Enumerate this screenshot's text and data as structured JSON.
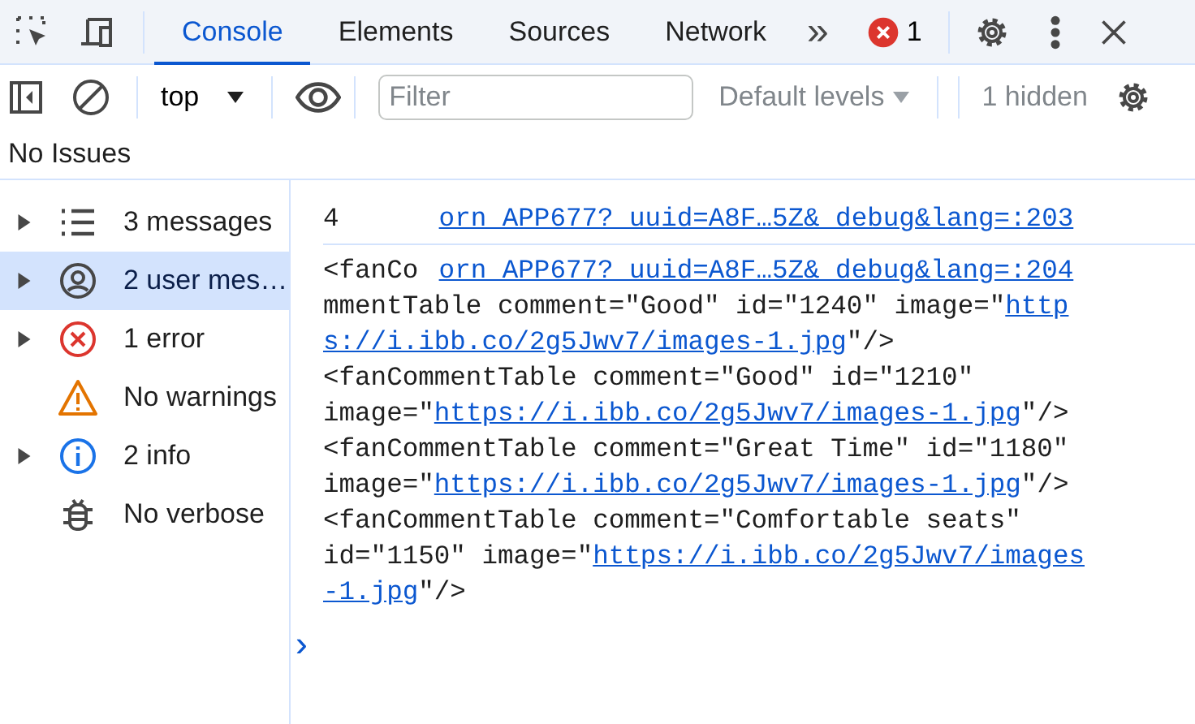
{
  "tabs": [
    {
      "label": "Console",
      "selected": true
    },
    {
      "label": "Elements",
      "selected": false
    },
    {
      "label": "Sources",
      "selected": false
    },
    {
      "label": "Network",
      "selected": false
    }
  ],
  "more_tabs": "»",
  "error_count": "1",
  "toolbar": {
    "context": "top",
    "filter": {
      "placeholder": "Filter"
    },
    "levels": "Default levels",
    "hidden": "1 hidden"
  },
  "issues": "No Issues",
  "sidebar": {
    "items": [
      {
        "label": "3 messages",
        "kind": "messages",
        "expandable": true,
        "selected": false
      },
      {
        "label": "2 user mes…",
        "kind": "user",
        "expandable": true,
        "selected": true
      },
      {
        "label": "1 error",
        "kind": "error",
        "expandable": true,
        "selected": false
      },
      {
        "label": "No warnings",
        "kind": "warning",
        "expandable": false,
        "selected": false
      },
      {
        "label": "2 info",
        "kind": "info",
        "expandable": true,
        "selected": false
      },
      {
        "label": "No verbose",
        "kind": "verbose",
        "expandable": false,
        "selected": false
      }
    ]
  },
  "console": {
    "messages": [
      {
        "source": "orn_APP677?_uuid=A8F…5Z&_debug&lang=:203",
        "head": "4"
      },
      {
        "source": "orn_APP677?_uuid=A8F…5Z&_debug&lang=:204",
        "head": "<fanCo",
        "parts": [
          {
            "kind": "text",
            "text": "mmentTable comment=\"Good\" id=\"1240\" image=\""
          },
          {
            "kind": "link",
            "text": "http"
          },
          {
            "kind": "link",
            "text": "s://i.ibb.co/2g5Jwv7/images-1.jpg"
          },
          {
            "kind": "text",
            "text": "\"/>\n<fanCommentTable comment=\"Good\" id=\"1210\" image=\""
          },
          {
            "kind": "link",
            "text": "https://i.ibb.co/2g5Jwv7/images-1.jpg"
          },
          {
            "kind": "text",
            "text": "\"/>\n<fanCommentTable comment=\"Great Time\" id=\"1180\" image=\""
          },
          {
            "kind": "link",
            "text": "https://i.ibb.co/2g5Jwv7/images-1.jpg"
          },
          {
            "kind": "text",
            "text": "\"/>\n<fanCommentTable comment=\"Comfortable seats\" id=\"1150\" image=\""
          },
          {
            "kind": "link",
            "text": "https://i.ibb.co/2g5Jwv7/images"
          },
          {
            "kind": "link",
            "text": "-1.jpg"
          },
          {
            "kind": "text",
            "text": "\"/>"
          }
        ]
      }
    ],
    "prompt": "›"
  }
}
